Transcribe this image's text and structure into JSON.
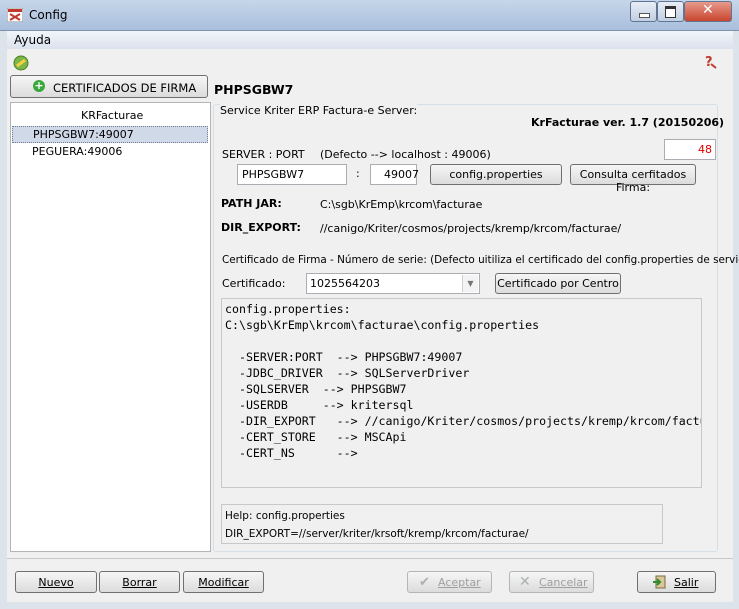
{
  "window": {
    "title": "Config"
  },
  "menu": {
    "help": "Ayuda"
  },
  "sidebar": {
    "cert_button": "CERTIFICADOS DE FIRMA",
    "list_header": "KRFacturae",
    "servers": [
      {
        "label": "PHPSGBW7:49007",
        "selected": true
      },
      {
        "label": "PEGUERA:49006",
        "selected": false
      }
    ]
  },
  "main": {
    "heading": "PHPSGBW7",
    "group_label": "Service Kriter ERP Factura-e Server:",
    "version": "KrFacturae ver. 1.7 (20150206)",
    "counter": "48",
    "server_port_label": "SERVER : PORT",
    "default_hint": "(Defecto --> localhost : 49006)",
    "server_value": "PHPSGBW7",
    "port_separator": ":",
    "port_value": "49007",
    "config_button": "config.properties",
    "consult_button": "Consulta cerfitados Firma:",
    "path_jar_label": "PATH JAR:",
    "path_jar_value": "C:\\sgb\\KrEmp\\krcom\\facturae",
    "dir_export_label": "DIR_EXPORT:",
    "dir_export_value": "//canigo/Kriter/cosmos/projects/kremp/krcom/facturae/",
    "cert_hint": "Certificado de Firma - Número de serie: (Defecto uitiliza el certificado del config.properties de servicio)",
    "cert_label": "Certificado:",
    "cert_value": "1025564203",
    "cert_center_button": "Certificado por Centro",
    "config_lines": [
      "config.properties:",
      "C:\\sgb\\KrEmp\\krcom\\facturae\\config.properties",
      "",
      "  -SERVER:PORT  --> PHPSGBW7:49007",
      "  -JDBC_DRIVER  --> SQLServerDriver",
      "  -SQLSERVER  --> PHPSGBW7",
      "  -USERDB     --> kritersql",
      "  -DIR_EXPORT   --> //canigo/Kriter/cosmos/projects/kremp/krcom/facturae/",
      "  -CERT_STORE   --> MSCApi",
      "  -CERT_NS      -->"
    ],
    "help_lines": [
      "Help: config.properties",
      "DIR_EXPORT=//server/kriter/krsoft/kremp/krcom/facturae/"
    ]
  },
  "footer": {
    "new": "Nuevo",
    "delete": "Borrar",
    "modify": "Modificar",
    "accept": "Aceptar",
    "cancel": "Cancelar",
    "exit": "Salir"
  }
}
